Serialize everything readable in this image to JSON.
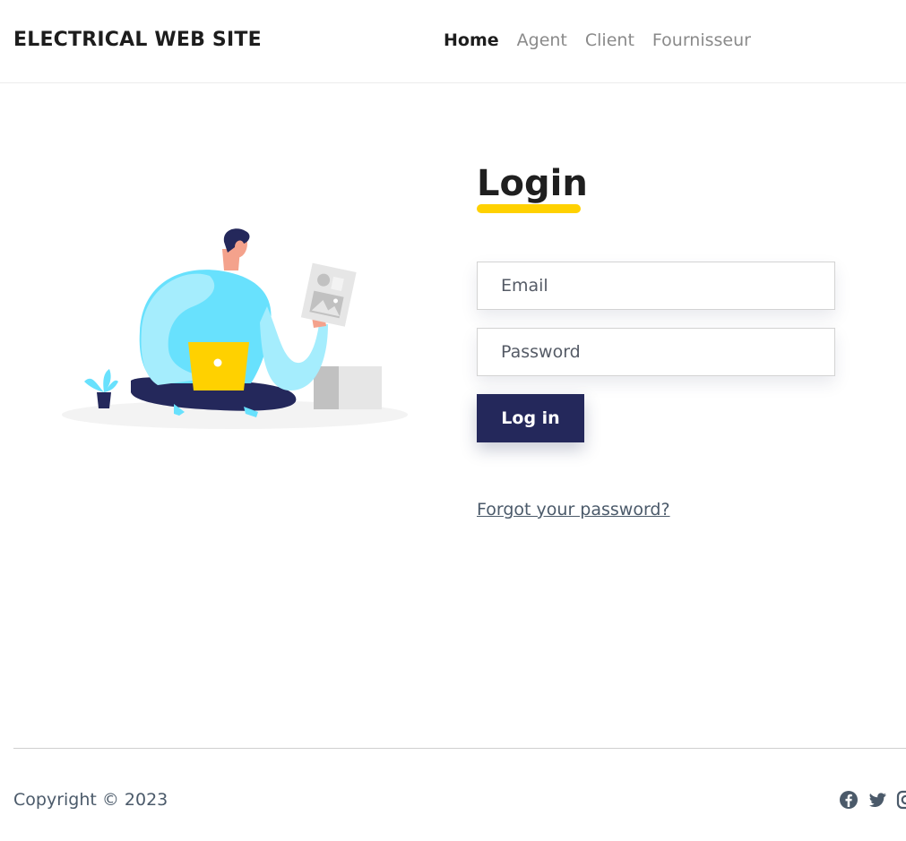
{
  "header": {
    "brand": "ELECTRICAL WEB SITE",
    "nav": [
      {
        "label": "Home",
        "active": true
      },
      {
        "label": "Agent",
        "active": false
      },
      {
        "label": "Client",
        "active": false
      },
      {
        "label": "Fournisseur",
        "active": false
      }
    ]
  },
  "login": {
    "title": "Login",
    "email_placeholder": "Email",
    "password_placeholder": "Password",
    "submit_label": "Log in",
    "forgot_link": "Forgot your password?"
  },
  "footer": {
    "copyright": "Copyright © 2023",
    "social_icons": [
      "facebook-icon",
      "twitter-icon",
      "instagram-icon"
    ]
  },
  "colors": {
    "accent_yellow": "#ffd100",
    "button_navy": "#24285b",
    "illustration_blue": "#68e1fd"
  }
}
